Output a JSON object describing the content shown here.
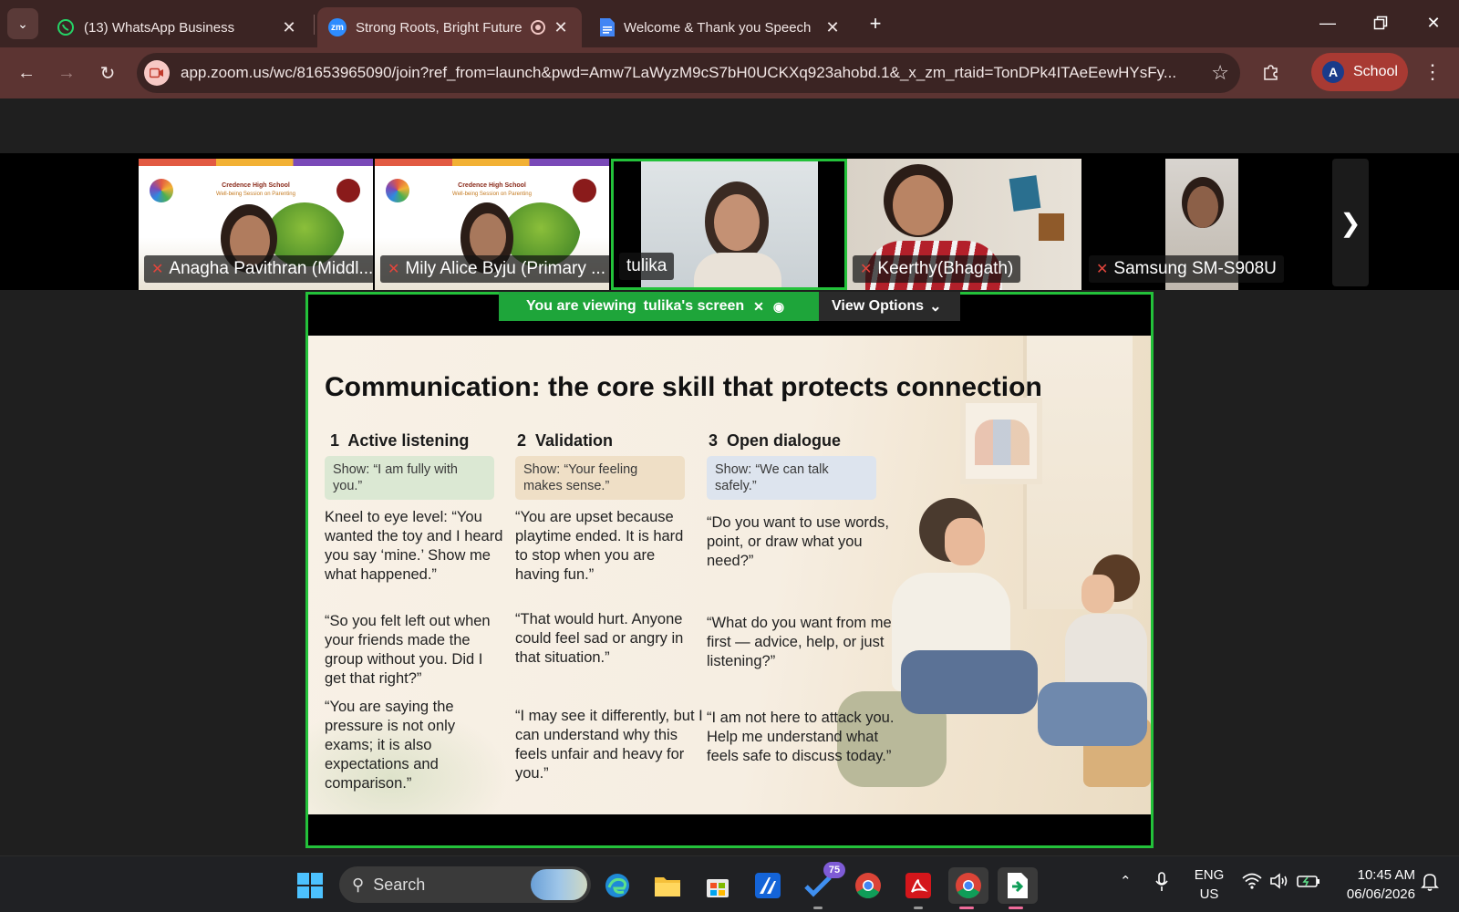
{
  "browser": {
    "tabs": [
      {
        "title": "(13) WhatsApp Business",
        "icon": "whatsapp-icon"
      },
      {
        "title": "Strong Roots, Bright Future",
        "icon": "zoom-icon",
        "active": true,
        "favicon_text": "zm"
      },
      {
        "title": "Welcome & Thank you Speech",
        "icon": "google-docs-icon"
      }
    ],
    "url": "app.zoom.us/wc/81653965090/join?ref_from=launch&pwd=Amw7LaWyzM9cS7bH0UCKXq923ahobd.1&_x_zm_rtaid=TonDPk4ITAeEewHYsFy...",
    "profile": {
      "initial": "A",
      "label": "School"
    }
  },
  "meeting": {
    "participants": [
      {
        "name": "Anagha Pavithran (Middl...",
        "muted": true
      },
      {
        "name": "Mily Alice Byju (Primary ...",
        "muted": true
      },
      {
        "name": "tulika",
        "muted": false,
        "active_speaker": true
      },
      {
        "name": "Keerthy(Bhagath)",
        "muted": true
      },
      {
        "name": "Samsung SM-S908U",
        "muted": true
      }
    ],
    "slide_thumb": {
      "school": "Credence High School",
      "subtitle": "Well-being Session on Parenting"
    },
    "viewing_banner": {
      "prefix": "You are viewing",
      "who": "tulika's screen"
    },
    "view_options_label": "View Options",
    "accent_color": "#23c13a"
  },
  "slide": {
    "title": "Communication: the core skill that protects connection",
    "columns": [
      {
        "number": "1",
        "heading": "Active listening",
        "show": "Show: “I am fully with you.”",
        "show_color": "#dbe8d3",
        "quotes": [
          "Kneel to eye level: “You wanted the toy and I heard you say ‘mine.’ Show me what happened.”",
          "“So you felt left out when your friends made the group without you. Did I get that right?”",
          "“You are saying the pressure is not only exams; it is also expectations and comparison.”"
        ]
      },
      {
        "number": "2",
        "heading": "Validation",
        "show": "Show: “Your feeling makes sense.”",
        "show_color": "#efdfc6",
        "quotes": [
          "“You are upset because playtime ended. It is hard to stop when you are having fun.”",
          "“That would hurt. Anyone could feel sad or angry in that situation.”",
          "“I may see it differently, but I can understand why this feels unfair and heavy for you.”"
        ]
      },
      {
        "number": "3",
        "heading": "Open dialogue",
        "show": "Show: “We can talk safely.”",
        "show_color": "#dde4ee",
        "quotes": [
          "“Do you want to use words, point, or draw what you need?”",
          "“What do you want from me first — advice, help, or just listening?”",
          "“I am not here to attack you. Help me understand what feels safe to discuss today.”"
        ]
      }
    ]
  },
  "taskbar": {
    "search_label": "Search",
    "todo_badge": "75",
    "language": {
      "line1": "ENG",
      "line2": "US"
    },
    "time": "10:45 AM",
    "date": "06/06/2026"
  }
}
